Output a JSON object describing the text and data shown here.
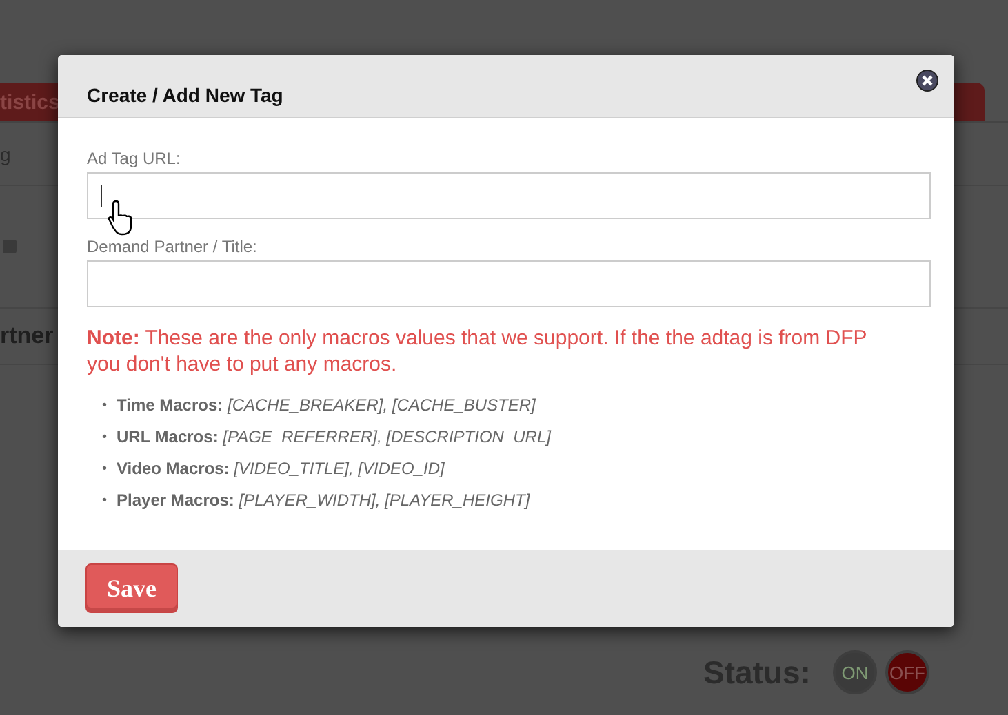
{
  "background": {
    "tab_label": "tistics",
    "row_text": "g",
    "heading": "rtner",
    "status_label": "Status:",
    "status_buttons": [
      {
        "label": "ON",
        "selected": false
      },
      {
        "label": "OFF",
        "selected": true
      }
    ]
  },
  "dialog": {
    "title": "Create / Add New Tag",
    "fields": [
      {
        "label": "Ad Tag URL:",
        "focused": true
      },
      {
        "label": "Demand Partner / Title:",
        "focused": false
      }
    ],
    "note": "**Note:** These are the only macros values that we support. If the the adtag is from DFP you don't have to put any macros.",
    "macros": [
      {
        "bullet": "•",
        "name": "Time Macros:",
        "values": "[CACHE_BREAKER], [CACHE_BUSTER]"
      },
      {
        "bullet": "•",
        "name": "URL Macros:",
        "values": "[PAGE_REFERRER], [DESCRIPTION_URL]"
      },
      {
        "bullet": "•",
        "name": "Video Macros:",
        "values": "[VIDEO_TITLE], [VIDEO_ID]"
      },
      {
        "bullet": "•",
        "name": "Player Macros:",
        "values": "[PLAYER_WIDTH], [PLAYER_HEIGHT]"
      }
    ],
    "save_button": "Save"
  }
}
